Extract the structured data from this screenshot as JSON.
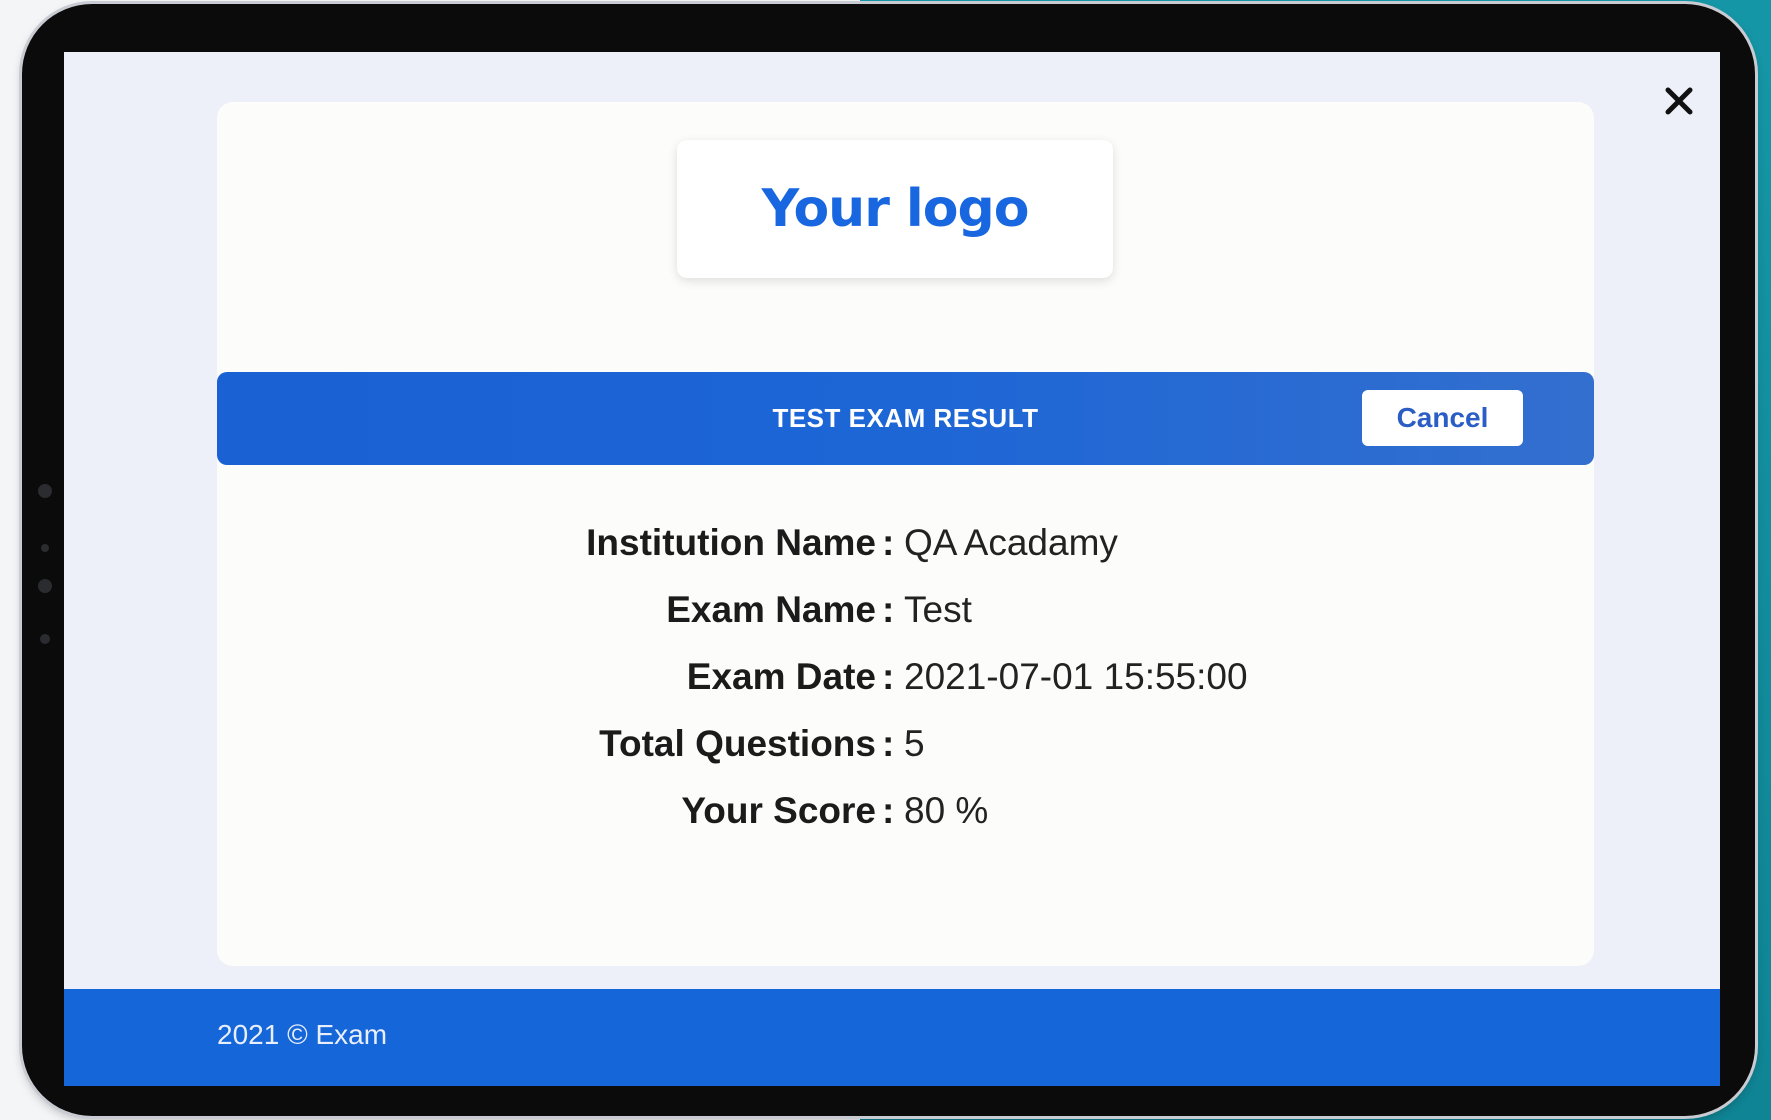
{
  "logo": {
    "text": "Your logo"
  },
  "header": {
    "title": "TEST EXAM RESULT",
    "cancel_label": "Cancel"
  },
  "result": {
    "rows": [
      {
        "label": "Institution Name",
        "value": "QA Acadamy"
      },
      {
        "label": "Exam Name",
        "value": "Test"
      },
      {
        "label": "Exam Date",
        "value": "2021-07-01 15:55:00"
      },
      {
        "label": "Total Questions",
        "value": "5"
      },
      {
        "label": "Your Score",
        "value": "80 %"
      }
    ],
    "separator": ":"
  },
  "footer": {
    "text": "2021 © Exam"
  },
  "icons": {
    "close": "close-icon"
  },
  "colors": {
    "accent": "#1866e0",
    "title_bar": "#1d66d6",
    "footer": "#1566d8",
    "screen_bg": "#edf0f8",
    "card_bg": "#fcfcfa"
  }
}
